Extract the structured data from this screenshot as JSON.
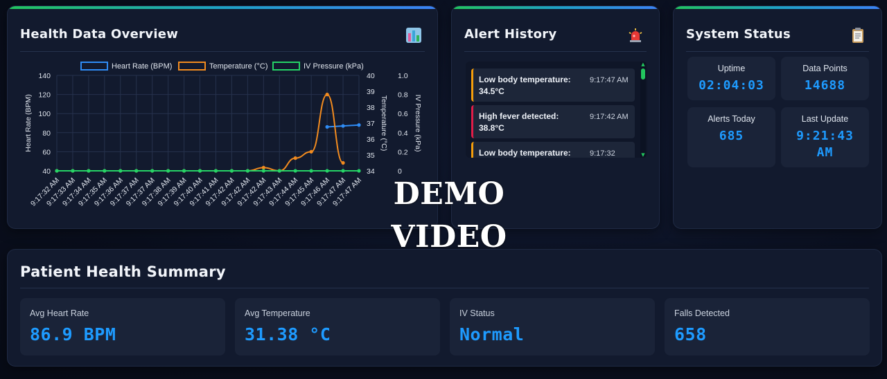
{
  "overview": {
    "title": "Health Data Overview",
    "icon": "bar-chart-icon"
  },
  "chart_data": {
    "type": "line",
    "legend_position": "top",
    "grid": true,
    "x": [
      "9:17:32 AM",
      "9:17:33 AM",
      "9:17:34 AM",
      "9:17:35 AM",
      "9:17:36 AM",
      "9:17:37 AM",
      "9:17:37 AM",
      "9:17:38 AM",
      "9:17:39 AM",
      "9:17:40 AM",
      "9:17:41 AM",
      "9:17:42 AM",
      "9:17:42 AM",
      "9:17:42 AM",
      "9:17:43 AM",
      "9:17:44 AM",
      "9:17:45 AM",
      "9:17:46 AM",
      "9:17:47 AM",
      "9:17:47 AM"
    ],
    "axes": {
      "y_left": {
        "label": "Heart Rate (BPM)",
        "ticks": [
          40,
          60,
          80,
          100,
          120,
          140
        ],
        "range": [
          40,
          140
        ]
      },
      "y_right1": {
        "label": "Temperature (°C)",
        "ticks": [
          34,
          35,
          36,
          37,
          38,
          39,
          40
        ],
        "range": [
          34,
          40
        ]
      },
      "y_right2": {
        "label": "IV Pressure (kPa)",
        "ticks": [
          "0",
          "0.2",
          "0.4",
          "0.6",
          "0.8",
          "1.0"
        ],
        "range": [
          0,
          1
        ]
      }
    },
    "series": [
      {
        "name": "Heart Rate (BPM)",
        "axis": "y_left",
        "color": "#2f8cf5",
        "values": [
          null,
          null,
          null,
          null,
          null,
          null,
          null,
          null,
          null,
          null,
          null,
          null,
          null,
          null,
          null,
          null,
          null,
          86,
          87,
          88
        ]
      },
      {
        "name": "Temperature (°C)",
        "axis": "y_right1",
        "color": "#f28b1f",
        "values": [
          34,
          34,
          34,
          34,
          34,
          34,
          34,
          34,
          34,
          34,
          34,
          34,
          34,
          34.2,
          34,
          34.8,
          35.2,
          38.8,
          34.5
        ]
      },
      {
        "name": "IV Pressure (kPa)",
        "axis": "y_right2",
        "color": "#25d366",
        "values": [
          0,
          0,
          0,
          0,
          0,
          0,
          0,
          0,
          0,
          0,
          0,
          0,
          0,
          0,
          0,
          0,
          0,
          0,
          0,
          0
        ]
      }
    ]
  },
  "alerts": {
    "title": "Alert History",
    "icon": "siren-icon",
    "items": [
      {
        "message": "Low body temperature: 34.5°C",
        "time": "9:17:47 AM",
        "level": "warning",
        "color": "#f59e0b"
      },
      {
        "message": "High fever detected: 38.8°C",
        "time": "9:17:42 AM",
        "level": "critical",
        "color": "#e11d48"
      },
      {
        "message": "Low body temperature:",
        "time": "9:17:32",
        "level": "warning",
        "color": "#f59e0b"
      }
    ]
  },
  "status": {
    "title": "System Status",
    "icon": "clipboard-icon",
    "uptime_label": "Uptime",
    "uptime_value": "02:04:03",
    "datapoints_label": "Data Points",
    "datapoints_value": "14688",
    "alerts_label": "Alerts Today",
    "alerts_value": "685",
    "update_label": "Last Update",
    "update_value_line1": "9:21:43",
    "update_value_line2": "AM"
  },
  "summary": {
    "title": "Patient Health Summary",
    "items": [
      {
        "label": "Avg Heart Rate",
        "value": "86.9 BPM"
      },
      {
        "label": "Avg Temperature",
        "value": "31.38 °C"
      },
      {
        "label": "IV Status",
        "value": "Normal"
      },
      {
        "label": "Falls Detected",
        "value": "658"
      }
    ]
  },
  "watermark": {
    "line1": "DEMO",
    "line2": "VIDEO"
  },
  "colors": {
    "accent": "#1e9bff",
    "background": "#0a0f1e",
    "card": "#121a2e"
  }
}
